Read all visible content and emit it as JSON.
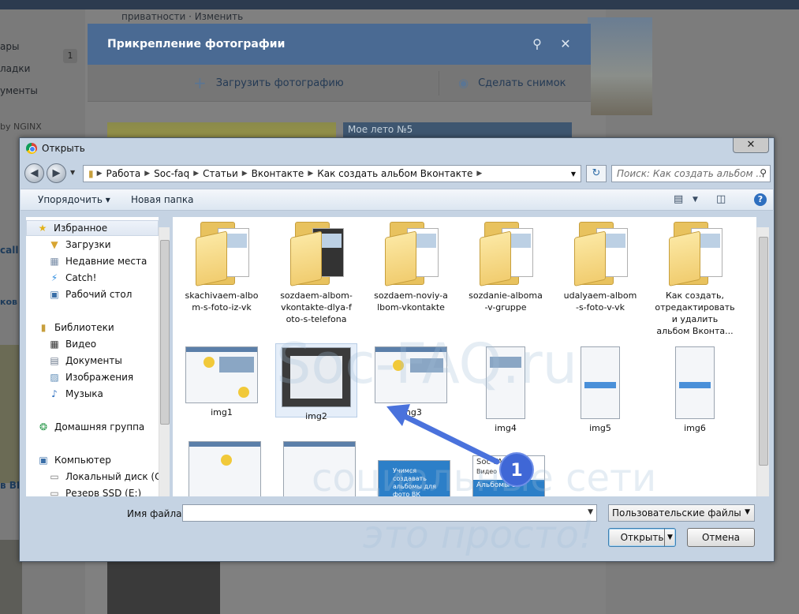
{
  "background": {
    "privacy_text": "приватности · Изменить",
    "nav": [
      "ары",
      "ладки",
      "ументы"
    ],
    "badge": "1",
    "by_text": "by NGINX",
    "side_text_1": "call",
    "side_text_2": "ков с",
    "side_text_3": "в ВК"
  },
  "vk_modal": {
    "title": "Прикрепление фотографии",
    "upload_label": "Загрузить фотографию",
    "snapshot_label": "Сделать снимок",
    "thumb_caption": "Мое лето №5"
  },
  "dialog": {
    "title": "Открыть",
    "close_glyph": "✕",
    "breadcrumbs": [
      "Работа",
      "Soc-faq",
      "Статьи",
      "Вконтакте",
      "Как создать альбом Вконтакте"
    ],
    "search_placeholder": "Поиск: Как создать альбом ...",
    "toolbar": {
      "organize": "Упорядочить ▾",
      "new_folder": "Новая папка"
    },
    "sidebar": {
      "favorites": {
        "label": "Избранное",
        "items": [
          "Загрузки",
          "Недавние места",
          "Catch!",
          "Рабочий стол"
        ]
      },
      "libraries": {
        "label": "Библиотеки",
        "items": [
          "Видео",
          "Документы",
          "Изображения",
          "Музыка"
        ]
      },
      "homegroup": "Домашняя группа",
      "computer": {
        "label": "Компьютер",
        "items": [
          "Локальный диск (C:)",
          "Резерв SSD (E:)"
        ]
      }
    },
    "folders": [
      "skachivaem-albo\nm-s-foto-iz-vk",
      "sozdaem-albom-\nvkontakte-dlya-f\noto-s-telefona",
      "sozdaem-noviy-a\nlbom-vkontakte",
      "sozdanie-alboma\n-v-gruppe",
      "udalyaem-albom\n-s-foto-v-vk",
      "Как создать,\nотредактировать\nи удалить\nальбом Вконта..."
    ],
    "images": [
      "img1",
      "img2",
      "img3",
      "img4",
      "img5",
      "img6"
    ],
    "partial_thumb_1": "Учимся создавать альбомы для фото ВК",
    "partial_thumb_2_title": "Soc-FA",
    "partial_thumb_2_sub": "Видео",
    "partial_thumb_2_body": "Альбомы в",
    "file_name_label": "Имя файла:",
    "file_name_value": "",
    "file_type": "Пользовательские файлы",
    "open_button": "Открыть",
    "cancel_button": "Отмена"
  },
  "annotation": {
    "marker": "1"
  },
  "watermark": {
    "line1": "Soc-FAQ.ru",
    "line2": "социальные сети",
    "line3": "это просто!"
  },
  "colors": {
    "vk_header": "#4a6a93",
    "marker": "#3f67d6",
    "selection": "#e5eef9"
  }
}
